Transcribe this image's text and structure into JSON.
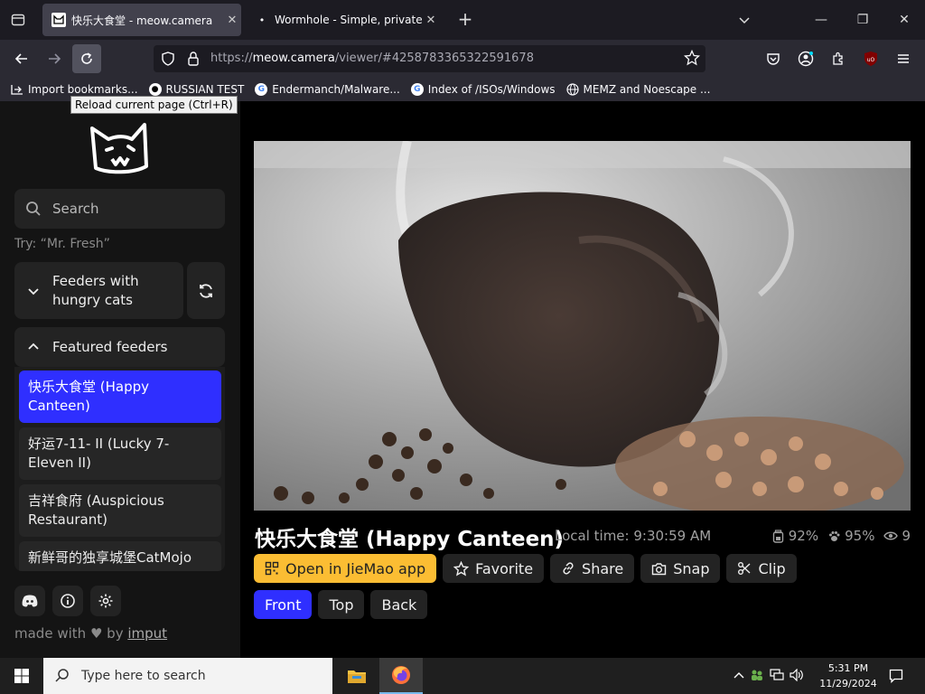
{
  "browser": {
    "tabs": [
      {
        "title": "快乐大食堂 - meow.camera",
        "active": true
      },
      {
        "title": "Wormhole - Simple, private file",
        "active": false
      }
    ],
    "url_dim_prefix": "https://",
    "url_host": "meow.camera",
    "url_rest": "/viewer/#4258783365322591678",
    "tooltip": "Reload current page (Ctrl+R)",
    "bookmarks": [
      {
        "label": "Import bookmarks...",
        "icon": "import-icon"
      },
      {
        "label": "RUSSIAN TEST",
        "icon": "github-icon"
      },
      {
        "label": "Endermanch/Malware...",
        "icon": "google-icon"
      },
      {
        "label": "Index of /ISOs/Windows",
        "icon": "google-icon"
      },
      {
        "label": "MEMZ and Noescape ...",
        "icon": "globe-icon"
      }
    ],
    "extension_badge": "uO"
  },
  "sidebar": {
    "search_placeholder": "Search",
    "hint": "Try: “Mr. Fresh”",
    "hungry_label": "Feeders with hungry cats",
    "featured_label": "Featured feeders",
    "feeders": [
      {
        "name": "快乐大食堂 (Happy Canteen)",
        "selected": true
      },
      {
        "name": "好运7-11- II  (Lucky 7-Eleven II)",
        "selected": false
      },
      {
        "name": "吉祥食府 (Auspicious Restaurant)",
        "selected": false
      },
      {
        "name": "新鲜哥的独享城堡CatMojo",
        "selected": false
      }
    ],
    "made_with_prefix": "made with",
    "made_with_by": "by",
    "made_with_author": "imput"
  },
  "viewer": {
    "title": "快乐大食堂 (Happy Canteen)",
    "local_time_label": "Local time: 9:30:59 AM",
    "food_level": "92%",
    "battery_level": "95%",
    "viewers": "9",
    "actions": {
      "open_app": "Open in JieMao app",
      "favorite": "Favorite",
      "share": "Share",
      "snap": "Snap",
      "clip": "Clip"
    },
    "cameras": [
      "Front",
      "Top",
      "Back"
    ]
  },
  "taskbar": {
    "search_placeholder": "Type here to search",
    "time": "5:31 PM",
    "date": "11/29/2024"
  },
  "colors": {
    "accent": "#2f2fff",
    "primary_button": "#fbbd33",
    "sidebar_bg": "#141414",
    "button_bg": "#232323"
  }
}
